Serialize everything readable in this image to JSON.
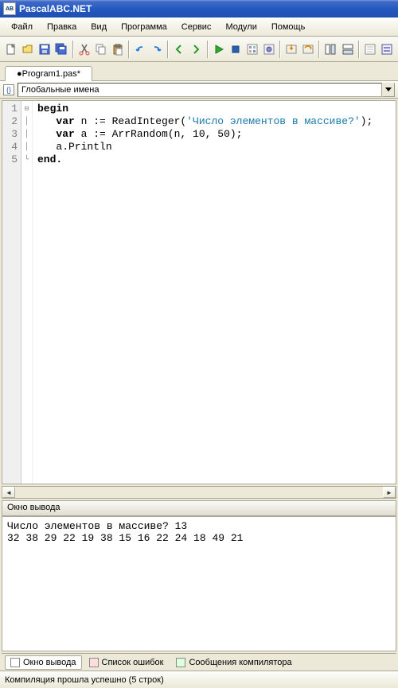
{
  "title": "PascalABC.NET",
  "menu": {
    "file": "Файл",
    "edit": "Правка",
    "view": "Вид",
    "program": "Программа",
    "service": "Сервис",
    "modules": "Модули",
    "help": "Помощь"
  },
  "scope": {
    "label": "Глобальные имена"
  },
  "tab": {
    "name": "●Program1.pas*"
  },
  "code": {
    "lines": [
      "1",
      "2",
      "3",
      "4",
      "5"
    ],
    "l1a": "begin",
    "l2a": "   ",
    "l2b": "var",
    "l2c": " n := ReadInteger(",
    "l2d": "'Число элементов в массиве?'",
    "l2e": ");",
    "l3a": "   ",
    "l3b": "var",
    "l3c": " a := ArrRandom(n, ",
    "l3d": "10",
    "l3e": ", ",
    "l3f": "50",
    "l3g": ");",
    "l4": "   a.Println",
    "l5": "end."
  },
  "outputPanel": {
    "title": "Окно вывода"
  },
  "output": {
    "line1": "Число элементов в массиве? 13",
    "line2": "32 38 29 22 19 38 15 16 22 24 18 49 21"
  },
  "bottomTabs": {
    "t1": "Окно вывода",
    "t2": "Список ошибок",
    "t3": "Сообщения компилятора"
  },
  "status": "Компиляция прошла успешно (5 строк)"
}
